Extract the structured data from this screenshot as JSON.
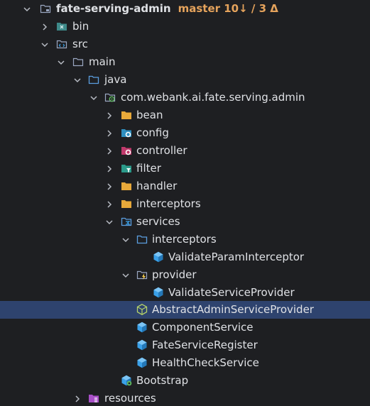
{
  "tree": {
    "root": {
      "label": "fate-serving-admin",
      "vcs_status": "master 10↓ / 3 Δ",
      "icon": "module-folder-icon"
    },
    "items": [
      {
        "label": "bin",
        "icon": "excluded-folder-icon",
        "expanded": false
      },
      {
        "label": "src",
        "icon": "source-folder-icon",
        "expanded": true
      },
      {
        "label": "main",
        "icon": "folder-icon",
        "expanded": true
      },
      {
        "label": "java",
        "icon": "source-root-icon",
        "expanded": true
      },
      {
        "label": "com.webank.ai.fate.serving.admin",
        "icon": "spring-package-icon",
        "expanded": true
      },
      {
        "label": "bean",
        "icon": "package-folder-icon",
        "expanded": false
      },
      {
        "label": "config",
        "icon": "config-package-icon",
        "expanded": false
      },
      {
        "label": "controller",
        "icon": "controller-package-icon",
        "expanded": false
      },
      {
        "label": "filter",
        "icon": "filter-package-icon",
        "expanded": false
      },
      {
        "label": "handler",
        "icon": "package-folder-icon",
        "expanded": false
      },
      {
        "label": "interceptors",
        "icon": "package-folder-icon",
        "expanded": false
      },
      {
        "label": "services",
        "icon": "service-package-icon",
        "expanded": true
      },
      {
        "label": "interceptors",
        "icon": "source-root-icon",
        "expanded": true
      },
      {
        "label": "ValidateParamInterceptor",
        "icon": "class-icon"
      },
      {
        "label": "provider",
        "icon": "provider-package-icon",
        "expanded": true
      },
      {
        "label": "ValidateServiceProvider",
        "icon": "class-icon"
      },
      {
        "label": "AbstractAdminServiceProvider",
        "icon": "abstract-class-icon",
        "selected": true
      },
      {
        "label": "ComponentService",
        "icon": "class-icon"
      },
      {
        "label": "FateServiceRegister",
        "icon": "class-icon"
      },
      {
        "label": "HealthCheckService",
        "icon": "class-icon"
      },
      {
        "label": "Bootstrap",
        "icon": "spring-boot-class-icon"
      },
      {
        "label": "resources",
        "icon": "resources-folder-icon",
        "expanded": false
      }
    ]
  },
  "colors": {
    "background": "#1e1f22",
    "selection": "#2e436e",
    "text": "#dfe1e5",
    "vcs": "#e5a35c",
    "class_icon": "#3aa0e8",
    "folder_outline": "#9aa7c1"
  }
}
